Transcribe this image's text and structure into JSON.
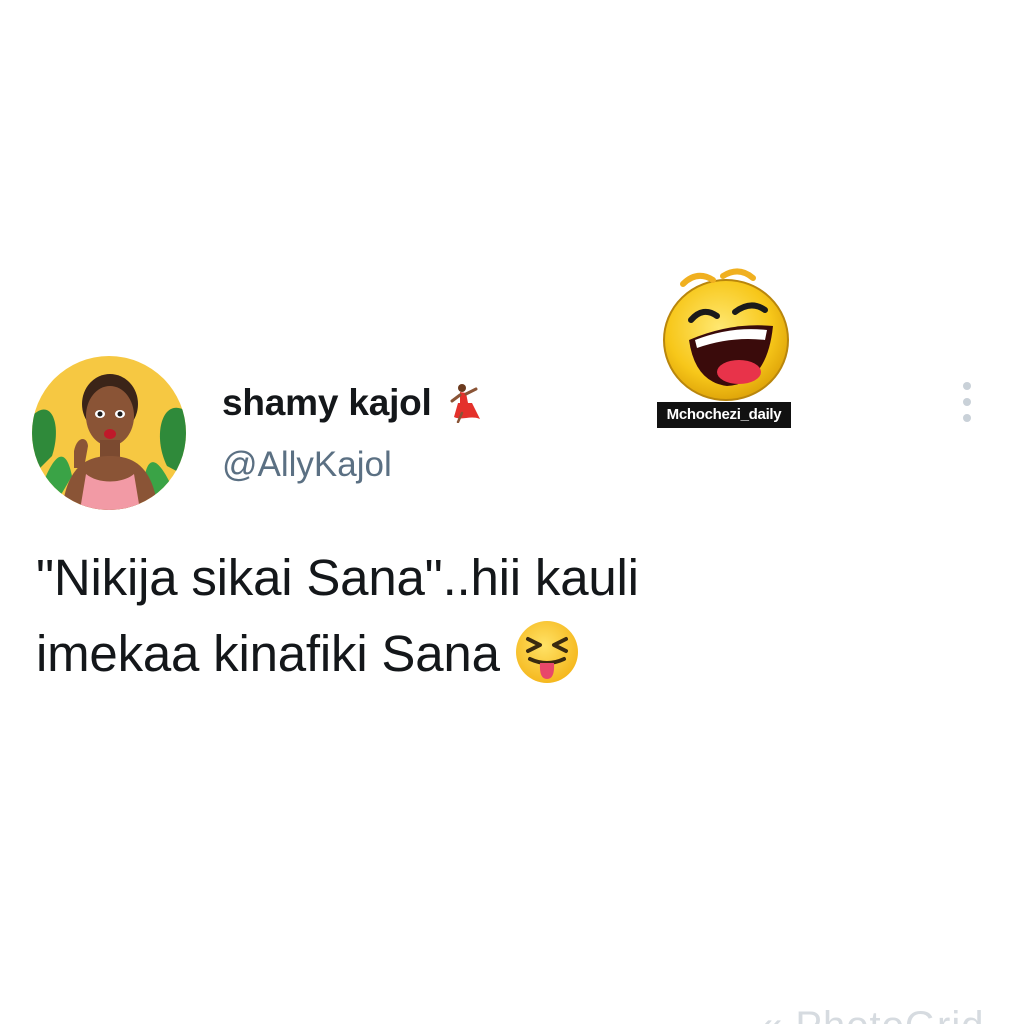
{
  "tweet": {
    "author": {
      "display_name": "shamy kajol",
      "name_emoji": "dancer-icon",
      "handle": "@AllyKajol"
    },
    "text_lines": [
      "\"Nikija sikai Sana\"..hii kauli",
      "imekaa kinafiki Sana"
    ],
    "trailing_emoji": "squinting-face-with-tongue-icon"
  },
  "watermark": {
    "icon": "laughing-face-icon",
    "label": "Mchochezi_daily"
  },
  "footer_watermark": {
    "text": "« PhotoGrid"
  },
  "colors": {
    "text_primary": "#14171a",
    "text_secondary": "#5b7083",
    "watermark_label_bg": "#111111",
    "emoji_yellow": "#ffcc33"
  }
}
